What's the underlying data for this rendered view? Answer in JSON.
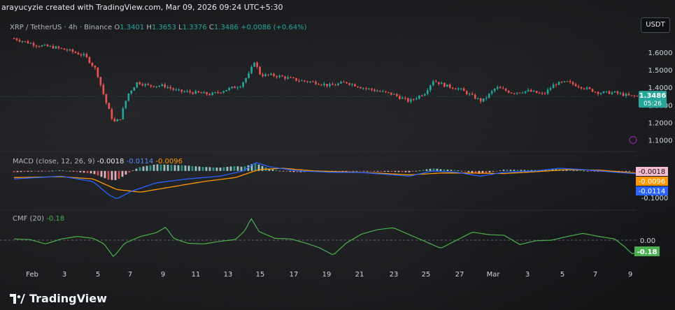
{
  "watermark": "arayucyzie created with TradingView.com, Mar 09, 2026 09:24 UTC+5:30",
  "currency_tag": "USDT",
  "symbol_line": {
    "symbol": "XRP / TetherUS · 4h · Binance",
    "o_label": "O",
    "o": "1.3401",
    "h_label": "H",
    "h": "1.3653",
    "l_label": "L",
    "l": "1.3376",
    "c_label": "C",
    "c": "1.3486",
    "change": "+0.0086 (+0.64%)"
  },
  "price_badge": {
    "price": "1.3486",
    "countdown": "05:26"
  },
  "macd_legend": {
    "label": "MACD (close, 12, 26, 9)",
    "hist": "-0.0018",
    "macd": "-0.0114",
    "signal": "-0.0096"
  },
  "cmf_legend": {
    "label": "CMF (20)",
    "value": "-0.18"
  },
  "brand": "TradingView",
  "colors": {
    "up": "#26a69a",
    "down": "#ef5350",
    "macd": "#2962ff",
    "signal": "#ff9800",
    "cmf": "#4caf50"
  },
  "chart_data": [
    {
      "type": "candlestick",
      "title": "XRP / TetherUS · 4h · Binance",
      "x_ticks": [
        "Feb",
        "3",
        "5",
        "7",
        "9",
        "11",
        "13",
        "15",
        "17",
        "19",
        "21",
        "23",
        "25",
        "27",
        "Mar",
        "3",
        "5",
        "7",
        "9"
      ],
      "y_ticks": [
        "1.6000",
        "1.5000",
        "1.4000",
        "1.3000",
        "1.2000",
        "1.1000"
      ],
      "ylim": [
        1.05,
        1.72
      ],
      "path": [
        [
          0,
          1.68
        ],
        [
          1.5,
          1.64
        ],
        [
          2.5,
          1.63
        ],
        [
          3.5,
          1.61
        ],
        [
          4.5,
          1.58
        ],
        [
          5.2,
          1.5
        ],
        [
          5.8,
          1.32
        ],
        [
          6.3,
          1.2
        ],
        [
          6.7,
          1.22
        ],
        [
          7.2,
          1.36
        ],
        [
          7.8,
          1.43
        ],
        [
          8.5,
          1.41
        ],
        [
          9.5,
          1.41
        ],
        [
          10.3,
          1.38
        ],
        [
          11.5,
          1.37
        ],
        [
          12.5,
          1.36
        ],
        [
          13.5,
          1.39
        ],
        [
          14.3,
          1.41
        ],
        [
          14.9,
          1.48
        ],
        [
          15.2,
          1.55
        ],
        [
          15.6,
          1.47
        ],
        [
          16.3,
          1.47
        ],
        [
          17.0,
          1.46
        ],
        [
          18.0,
          1.44
        ],
        [
          19.0,
          1.43
        ],
        [
          20.0,
          1.41
        ],
        [
          21.0,
          1.43
        ],
        [
          22.0,
          1.4
        ],
        [
          23.0,
          1.38
        ],
        [
          24.0,
          1.36
        ],
        [
          25.0,
          1.32
        ],
        [
          26.0,
          1.37
        ],
        [
          26.5,
          1.44
        ],
        [
          27.3,
          1.41
        ],
        [
          28.2,
          1.39
        ],
        [
          29.0,
          1.35
        ],
        [
          29.6,
          1.32
        ],
        [
          30.5,
          1.4
        ],
        [
          31.5,
          1.37
        ],
        [
          32.5,
          1.38
        ],
        [
          33.5,
          1.36
        ],
        [
          34.2,
          1.42
        ],
        [
          35.0,
          1.43
        ],
        [
          36.0,
          1.4
        ],
        [
          37.0,
          1.37
        ],
        [
          38.0,
          1.37
        ],
        [
          39.0,
          1.35
        ],
        [
          39.6,
          1.349
        ]
      ],
      "last_price": 1.3486,
      "candle_count": 225
    },
    {
      "type": "macd",
      "title": "MACD (close, 12, 26, 9)",
      "y_ticks": [
        "-0.1000"
      ],
      "ylim": [
        -0.14,
        0.06
      ],
      "macd_path": [
        [
          0,
          -0.03
        ],
        [
          3,
          -0.02
        ],
        [
          5,
          -0.04
        ],
        [
          6,
          -0.09
        ],
        [
          6.5,
          -0.105
        ],
        [
          7.5,
          -0.075
        ],
        [
          9,
          -0.045
        ],
        [
          11,
          -0.03
        ],
        [
          13,
          -0.02
        ],
        [
          14.5,
          0.0
        ],
        [
          15.3,
          0.032
        ],
        [
          16.2,
          0.015
        ],
        [
          18,
          0.0
        ],
        [
          20,
          -0.005
        ],
        [
          22,
          -0.006
        ],
        [
          24,
          -0.015
        ],
        [
          25,
          -0.02
        ],
        [
          26.5,
          0.0
        ],
        [
          28,
          -0.005
        ],
        [
          29.5,
          -0.02
        ],
        [
          31,
          -0.005
        ],
        [
          33,
          0.0
        ],
        [
          34.5,
          0.01
        ],
        [
          36,
          0.005
        ],
        [
          38,
          -0.005
        ],
        [
          39.6,
          -0.0114
        ]
      ],
      "signal_path": [
        [
          0,
          -0.025
        ],
        [
          3,
          -0.022
        ],
        [
          5,
          -0.03
        ],
        [
          6.5,
          -0.07
        ],
        [
          8,
          -0.08
        ],
        [
          10,
          -0.06
        ],
        [
          12,
          -0.04
        ],
        [
          14,
          -0.025
        ],
        [
          15.5,
          0.005
        ],
        [
          17,
          0.01
        ],
        [
          19,
          0.0
        ],
        [
          21,
          -0.004
        ],
        [
          23,
          -0.008
        ],
        [
          25,
          -0.015
        ],
        [
          27,
          -0.008
        ],
        [
          29,
          -0.008
        ],
        [
          31,
          -0.01
        ],
        [
          33,
          -0.003
        ],
        [
          35,
          0.005
        ],
        [
          37,
          0.003
        ],
        [
          39.6,
          -0.0096
        ]
      ],
      "last": {
        "hist": -0.0018,
        "signal": -0.0096,
        "macd": -0.0114
      }
    },
    {
      "type": "line",
      "title": "CMF (20)",
      "y_ticks": [
        "0.00"
      ],
      "ylim": [
        -0.45,
        0.45
      ],
      "path": [
        [
          0,
          0.02
        ],
        [
          1,
          0.01
        ],
        [
          2,
          -0.06
        ],
        [
          3,
          0.02
        ],
        [
          4,
          0.06
        ],
        [
          5,
          0.03
        ],
        [
          5.7,
          -0.06
        ],
        [
          6.3,
          -0.27
        ],
        [
          7.0,
          -0.05
        ],
        [
          8.0,
          0.06
        ],
        [
          9.0,
          0.12
        ],
        [
          9.6,
          0.21
        ],
        [
          10.1,
          0.03
        ],
        [
          11,
          -0.05
        ],
        [
          12,
          -0.06
        ],
        [
          13,
          -0.02
        ],
        [
          14,
          0.01
        ],
        [
          14.6,
          0.15
        ],
        [
          15.0,
          0.35
        ],
        [
          15.5,
          0.14
        ],
        [
          16.5,
          0.03
        ],
        [
          17.5,
          0.02
        ],
        [
          18.5,
          -0.05
        ],
        [
          19.3,
          -0.12
        ],
        [
          20.2,
          -0.24
        ],
        [
          21,
          -0.05
        ],
        [
          22,
          0.1
        ],
        [
          23,
          0.17
        ],
        [
          24,
          0.2
        ],
        [
          25,
          0.09
        ],
        [
          26,
          -0.02
        ],
        [
          27,
          -0.13
        ],
        [
          28,
          0.0
        ],
        [
          29,
          0.13
        ],
        [
          30,
          0.09
        ],
        [
          31,
          0.08
        ],
        [
          32,
          -0.07
        ],
        [
          33,
          -0.01
        ],
        [
          34,
          0.0
        ],
        [
          35,
          0.06
        ],
        [
          36,
          0.11
        ],
        [
          37,
          0.06
        ],
        [
          38,
          0.02
        ],
        [
          38.6,
          -0.1
        ],
        [
          39.1,
          -0.22
        ],
        [
          39.6,
          -0.18
        ]
      ]
    }
  ]
}
